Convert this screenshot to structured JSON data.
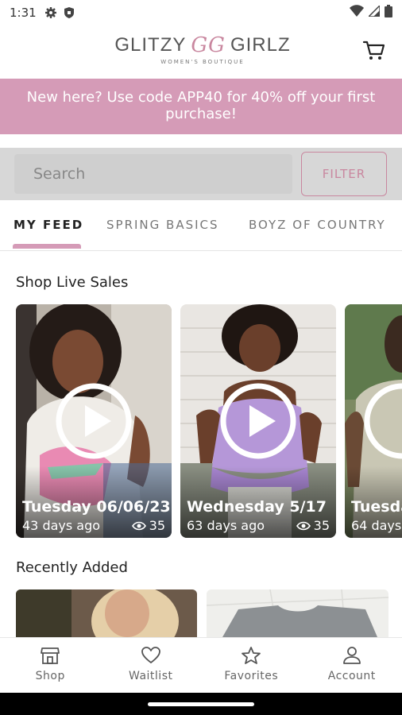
{
  "status_bar": {
    "time": "1:31"
  },
  "header": {
    "logo_left": "GLITZY",
    "logo_monogram": "GG",
    "logo_right": "GIRLZ",
    "logo_tagline": "WOMEN'S BOUTIQUE"
  },
  "promo": {
    "text": "New here? Use code APP40 for 40% off your first purchase!"
  },
  "search": {
    "placeholder": "Search",
    "filter_label": "FILTER"
  },
  "tabs": [
    {
      "label": "MY FEED",
      "active": true
    },
    {
      "label": "SPRING BASICS",
      "active": false
    },
    {
      "label": "BOYZ OF COUNTRY",
      "active": false
    }
  ],
  "live_sales": {
    "title": "Shop Live Sales",
    "items": [
      {
        "title": "Tuesday 06/06/23",
        "ago": "43 days ago",
        "views": "35"
      },
      {
        "title": "Wednesday 5/17",
        "ago": "63 days ago",
        "views": "35"
      },
      {
        "title": "Tuesday",
        "ago": "64 days",
        "views": ""
      }
    ]
  },
  "recent": {
    "title": "Recently Added"
  },
  "bottom_nav": [
    {
      "label": "Shop",
      "icon": "shop-icon"
    },
    {
      "label": "Waitlist",
      "icon": "heart-icon"
    },
    {
      "label": "Favorites",
      "icon": "star-icon"
    },
    {
      "label": "Account",
      "icon": "account-icon"
    }
  ],
  "colors": {
    "brand_pink": "#d59bb7",
    "accent_pink": "#c9879f"
  }
}
